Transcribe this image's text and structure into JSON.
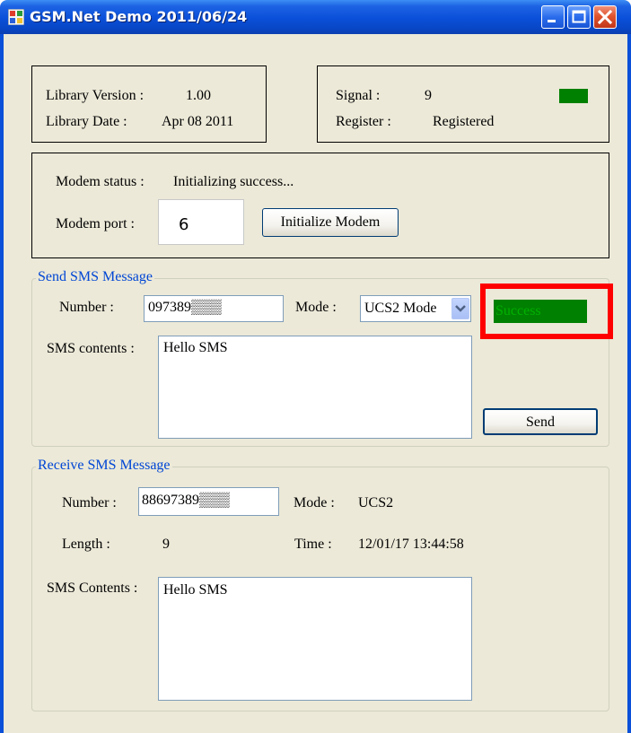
{
  "window": {
    "title": "GSM.Net Demo 2011/06/24",
    "icon": "app-window-icon",
    "controls": [
      "minimize-icon",
      "maximize-icon",
      "close-icon"
    ]
  },
  "library": {
    "version_label": "Library Version :",
    "version_value": "1.00",
    "date_label": "Library Date :",
    "date_value": "Apr 08 2011"
  },
  "signal": {
    "signal_label": "Signal :",
    "signal_value": "9",
    "register_label": "Register :",
    "register_value": "Registered",
    "indicator_color": "#008000"
  },
  "modem": {
    "status_label": "Modem status :",
    "status_value": "Initializing success...",
    "port_label": "Modem port :",
    "port_value": "6",
    "init_button": "Initialize Modem"
  },
  "send": {
    "legend": "Send SMS Message",
    "number_label": "Number :",
    "number_value": "097389▒▒▒",
    "mode_label": "Mode :",
    "mode_value": "UCS2 Mode",
    "status_text": "Success",
    "status_color": "#008000",
    "contents_label": "SMS contents :",
    "contents_value": "Hello SMS",
    "send_button": "Send",
    "highlight_color": "#ff0000"
  },
  "receive": {
    "legend": "Receive SMS Message",
    "number_label": "Number :",
    "number_value": "88697389▒▒▒",
    "mode_label": "Mode :",
    "mode_value": "UCS2",
    "length_label": "Length :",
    "length_value": "9",
    "time_label": "Time :",
    "time_value": "12/01/17 13:44:58",
    "contents_label": "SMS Contents :",
    "contents_value": "Hello SMS"
  }
}
